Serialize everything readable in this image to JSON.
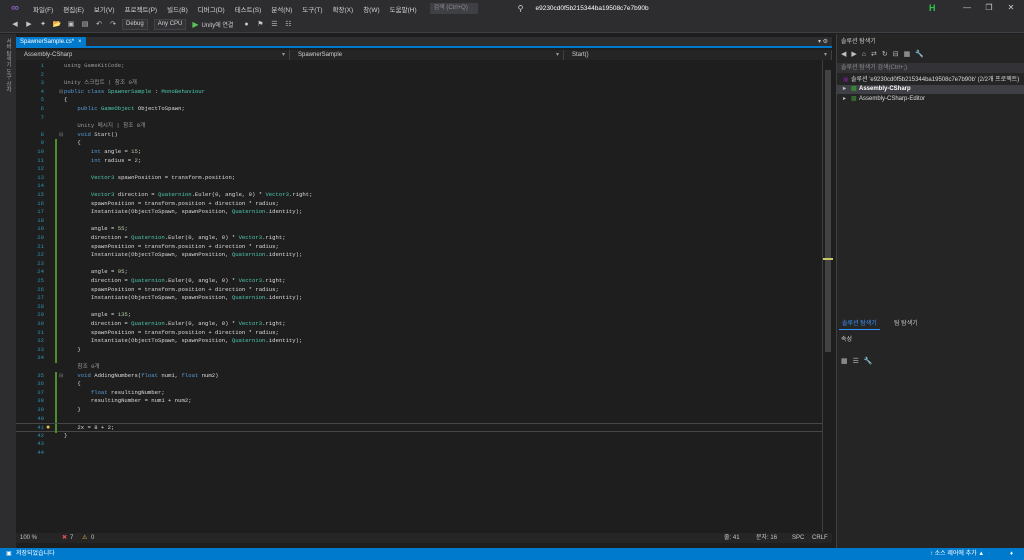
{
  "menubar": {
    "items": [
      "파일(F)",
      "편집(E)",
      "보기(V)",
      "프로젝트(P)",
      "빌드(B)",
      "디버그(D)",
      "테스트(S)",
      "분석(N)",
      "도구(T)",
      "확장(X)",
      "창(W)",
      "도움말(H)"
    ],
    "search_placeholder": "검색 (Ctrl+Q)",
    "project_title": "e9230cd0f5b215344ba19508c7e7b90b",
    "live_share_badge": "H"
  },
  "toolbar": {
    "config": "Debug",
    "platform": "Any CPU",
    "attach_label": "Unity에 연결"
  },
  "left_strip": {
    "label": "서버 탐색기  도구 상자"
  },
  "editor": {
    "tab_label": "SpawnerSample.cs*",
    "nav_project": "Assembly-CSharp",
    "nav_class": "SpawnerSample",
    "nav_member": "Start()",
    "lines": [
      {
        "n": "1",
        "segs": [
          {
            "t": "using GameKitCode;",
            "c": "ref"
          }
        ]
      },
      {
        "n": "2",
        "segs": []
      },
      {
        "n": "3",
        "segs": [
          {
            "t": "Unity 스크립트 | 참조 0개",
            "c": "ref"
          }
        ]
      },
      {
        "n": "4",
        "segs": [
          {
            "t": "public class ",
            "c": "kw"
          },
          {
            "t": "SpawnerSample",
            "c": "ty"
          },
          {
            "t": " : ",
            "c": ""
          },
          {
            "t": "MonoBehaviour",
            "c": "ty"
          }
        ]
      },
      {
        "n": "5",
        "segs": [
          {
            "t": "{",
            "c": ""
          }
        ]
      },
      {
        "n": "6",
        "segs": [
          {
            "t": "    public ",
            "c": "kw"
          },
          {
            "t": "GameObject",
            "c": "ty"
          },
          {
            "t": " ObjectToSpawn;",
            "c": ""
          }
        ]
      },
      {
        "n": "7",
        "segs": []
      },
      {
        "n": "",
        "segs": [
          {
            "t": "    Unity 메시지 | 참조 0개",
            "c": "ref"
          }
        ]
      },
      {
        "n": "8",
        "segs": [
          {
            "t": "    void ",
            "c": "kw"
          },
          {
            "t": "Start()",
            "c": ""
          }
        ]
      },
      {
        "n": "9",
        "segs": [
          {
            "t": "    {",
            "c": ""
          }
        ]
      },
      {
        "n": "10",
        "segs": [
          {
            "t": "        int ",
            "c": "kw"
          },
          {
            "t": "angle = ",
            "c": ""
          },
          {
            "t": "15",
            "c": "nm"
          },
          {
            "t": ";",
            "c": ""
          }
        ]
      },
      {
        "n": "11",
        "segs": [
          {
            "t": "        int ",
            "c": "kw"
          },
          {
            "t": "radius = ",
            "c": ""
          },
          {
            "t": "2",
            "c": "nm"
          },
          {
            "t": ";",
            "c": ""
          }
        ]
      },
      {
        "n": "12",
        "segs": []
      },
      {
        "n": "13",
        "segs": [
          {
            "t": "        Vector3",
            "c": "ty"
          },
          {
            "t": " spawnPosition = transform.position;",
            "c": ""
          }
        ]
      },
      {
        "n": "14",
        "segs": []
      },
      {
        "n": "15",
        "segs": [
          {
            "t": "        Vector3",
            "c": "ty"
          },
          {
            "t": " direction = ",
            "c": ""
          },
          {
            "t": "Quaternion",
            "c": "ty"
          },
          {
            "t": ".Euler(0, angle, 0) * ",
            "c": ""
          },
          {
            "t": "Vector3",
            "c": "ty"
          },
          {
            "t": ".right;",
            "c": ""
          }
        ]
      },
      {
        "n": "16",
        "segs": [
          {
            "t": "        spawnPosition = transform.position + direction * radius;",
            "c": ""
          }
        ]
      },
      {
        "n": "17",
        "segs": [
          {
            "t": "        Instantiate(ObjectToSpawn, spawnPosition, ",
            "c": ""
          },
          {
            "t": "Quaternion",
            "c": "ty"
          },
          {
            "t": ".identity);",
            "c": ""
          }
        ]
      },
      {
        "n": "18",
        "segs": []
      },
      {
        "n": "19",
        "segs": [
          {
            "t": "        angle = ",
            "c": ""
          },
          {
            "t": "55",
            "c": "nm"
          },
          {
            "t": ";",
            "c": ""
          }
        ]
      },
      {
        "n": "20",
        "segs": [
          {
            "t": "        direction = ",
            "c": ""
          },
          {
            "t": "Quaternion",
            "c": "ty"
          },
          {
            "t": ".Euler(0, angle, 0) * ",
            "c": ""
          },
          {
            "t": "Vector3",
            "c": "ty"
          },
          {
            "t": ".right;",
            "c": ""
          }
        ]
      },
      {
        "n": "21",
        "segs": [
          {
            "t": "        spawnPosition = transform.position + direction * radius;",
            "c": ""
          }
        ]
      },
      {
        "n": "22",
        "segs": [
          {
            "t": "        Instantiate(ObjectToSpawn, spawnPosition, ",
            "c": ""
          },
          {
            "t": "Quaternion",
            "c": "ty"
          },
          {
            "t": ".identity);",
            "c": ""
          }
        ]
      },
      {
        "n": "23",
        "segs": []
      },
      {
        "n": "24",
        "segs": [
          {
            "t": "        angle = ",
            "c": ""
          },
          {
            "t": "95",
            "c": "nm"
          },
          {
            "t": ";",
            "c": ""
          }
        ]
      },
      {
        "n": "25",
        "segs": [
          {
            "t": "        direction = ",
            "c": ""
          },
          {
            "t": "Quaternion",
            "c": "ty"
          },
          {
            "t": ".Euler(0, angle, 0) * ",
            "c": ""
          },
          {
            "t": "Vector3",
            "c": "ty"
          },
          {
            "t": ".right;",
            "c": ""
          }
        ]
      },
      {
        "n": "26",
        "segs": [
          {
            "t": "        spawnPosition = transform.position + direction * radius;",
            "c": ""
          }
        ]
      },
      {
        "n": "27",
        "segs": [
          {
            "t": "        Instantiate(ObjectToSpawn, spawnPosition, ",
            "c": ""
          },
          {
            "t": "Quaternion",
            "c": "ty"
          },
          {
            "t": ".identity);",
            "c": ""
          }
        ]
      },
      {
        "n": "28",
        "segs": []
      },
      {
        "n": "29",
        "segs": [
          {
            "t": "        angle = ",
            "c": ""
          },
          {
            "t": "135",
            "c": "nm"
          },
          {
            "t": ";",
            "c": ""
          }
        ]
      },
      {
        "n": "30",
        "segs": [
          {
            "t": "        direction = ",
            "c": ""
          },
          {
            "t": "Quaternion",
            "c": "ty"
          },
          {
            "t": ".Euler(0, angle, 0) * ",
            "c": ""
          },
          {
            "t": "Vector3",
            "c": "ty"
          },
          {
            "t": ".right;",
            "c": ""
          }
        ]
      },
      {
        "n": "31",
        "segs": [
          {
            "t": "        spawnPosition = transform.position + direction * radius;",
            "c": ""
          }
        ]
      },
      {
        "n": "32",
        "segs": [
          {
            "t": "        Instantiate(ObjectToSpawn, spawnPosition, ",
            "c": ""
          },
          {
            "t": "Quaternion",
            "c": "ty"
          },
          {
            "t": ".identity);",
            "c": ""
          }
        ]
      },
      {
        "n": "33",
        "segs": [
          {
            "t": "    }",
            "c": ""
          }
        ]
      },
      {
        "n": "34",
        "segs": []
      },
      {
        "n": "",
        "segs": [
          {
            "t": "    참조 0개",
            "c": "ref"
          }
        ]
      },
      {
        "n": "35",
        "segs": [
          {
            "t": "    void ",
            "c": "kw"
          },
          {
            "t": "AddingNumbers(",
            "c": ""
          },
          {
            "t": "float ",
            "c": "kw"
          },
          {
            "t": "num1, ",
            "c": ""
          },
          {
            "t": "float ",
            "c": "kw"
          },
          {
            "t": "num2)",
            "c": ""
          }
        ]
      },
      {
        "n": "36",
        "segs": [
          {
            "t": "    {",
            "c": ""
          }
        ]
      },
      {
        "n": "37",
        "segs": [
          {
            "t": "        float ",
            "c": "kw"
          },
          {
            "t": "resultingNumber;",
            "c": ""
          }
        ]
      },
      {
        "n": "38",
        "segs": [
          {
            "t": "        resultingNumber = num1 + num2;",
            "c": ""
          }
        ]
      },
      {
        "n": "39",
        "segs": [
          {
            "t": "    }",
            "c": ""
          }
        ]
      },
      {
        "n": "40",
        "segs": []
      },
      {
        "n": "41",
        "segs": [
          {
            "t": "    2x = 8 + 2;",
            "c": ""
          }
        ]
      },
      {
        "n": "42",
        "segs": [
          {
            "t": "}",
            "c": ""
          }
        ]
      },
      {
        "n": "43",
        "segs": []
      },
      {
        "n": "44",
        "segs": []
      }
    ],
    "zoom": "100 %",
    "errors": "7",
    "warnings": "0",
    "line_info": "줄: 41",
    "col_info": "문자: 16",
    "spc": "SPC",
    "crlf": "CRLF"
  },
  "solution_explorer": {
    "title": "솔루션 탐색기",
    "search_placeholder": "솔루션 탐색기 검색(Ctrl+;)",
    "solution_label": "솔루션 'e9230cd0f5b215344ba19508c7e7b90b' (2/2개 프로젝트)",
    "projects": [
      "Assembly-CSharp",
      "Assembly-CSharp-Editor"
    ],
    "bottom_tabs": [
      "솔루션 탐색기",
      "팀 탐색기"
    ]
  },
  "properties": {
    "title": "속성"
  },
  "statusbar": {
    "left": "저장되었습니다",
    "right": "↑ 소스 제어에 추가 ▲"
  },
  "colors": {
    "accent": "#007acc",
    "keyword": "#569cd6",
    "type": "#4ec9b0",
    "number": "#b5cea8"
  }
}
